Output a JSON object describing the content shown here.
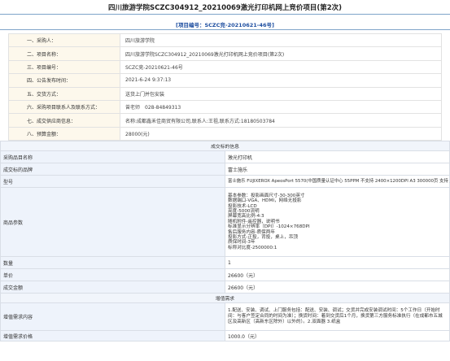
{
  "title": "四川旅游学院SCZC304912_20210069激光打印机网上竞价项目(第2次)",
  "subtitle": "[项目编号：SCZC竞-20210621-46号]",
  "info": [
    {
      "key": "一、采购人：",
      "value": "四川旅游学院"
    },
    {
      "key": "二、项目名称：",
      "value": "四川旅游学院SCZC304912_20210069激光打印机网上竞价项目(第2次)"
    },
    {
      "key": "三、项目编号：",
      "value": "SCZC竞-20210621-46号"
    },
    {
      "key": "四、公告发布时间：",
      "value": "2021-6-24 9:37:13"
    },
    {
      "key": "五、交货方式：",
      "value": "送货上门并包安装"
    },
    {
      "key": "六、采购项目联系人及联系方式：",
      "label": "曾老师",
      "value": "028-84849313"
    },
    {
      "key": "七、成交供应商信息：",
      "value": "名称:成都鑫禾佳商贸有限公司,联系人:王祖,联系方式:18180503784"
    },
    {
      "key": "八、预算金额：",
      "value": "28000(元)"
    }
  ],
  "details": {
    "section1": "成交标的信息",
    "rows": [
      {
        "key": "采购品目名称",
        "value": "激光打印机"
      },
      {
        "key": "成交标的品牌",
        "value": "富士施乐"
      },
      {
        "key": "型号",
        "value": "富士施乐 FUJIXEROX ApeosPort 5570(中国质量认证中心 55PPM 不支持 2400×1200DPI A3 300000页 支持 支持 1年 联系分离 )激光打印机"
      }
    ],
    "params_key": "商品参数",
    "params": [
      "基本参数：投影画面尺寸-30-300英寸",
      "数据端口-VGA、HDMI，网络无投影",
      "投影技术-LCD",
      "亮度-5000流明",
      "屏幕宽高比例-4:3",
      "随机附件-遥控器，说明书",
      "标准显示分辨率（DPI）-1024×768DPI",
      "售后服务内容-质保两年",
      "投影方式-正投，背投，桌上，吊顶",
      "质保时间-3年",
      "标称对比度-2500000:1"
    ],
    "qty_key": "数量",
    "qty": "1",
    "price_key": "单价",
    "price": "26600（元）",
    "total_key": "成交金额",
    "total": "26600（元）",
    "section2": "增值需求",
    "service_key": "增值需求内容",
    "service_value": "1.配送、安装、调试、上门服务包括：配送、安装、调试；交货并完成安装调试时间：5个工作日（开始时间：与客户签定合同的时间为准）；换货时间：着到交货后1个月，换货第三方服务标准执行（在成都市五城区及高新区（高新东区除外）以外的）。2.双面器 3.纸盒",
    "service_price_key": "增值需求价格",
    "service_price": "1000.0（元）"
  }
}
